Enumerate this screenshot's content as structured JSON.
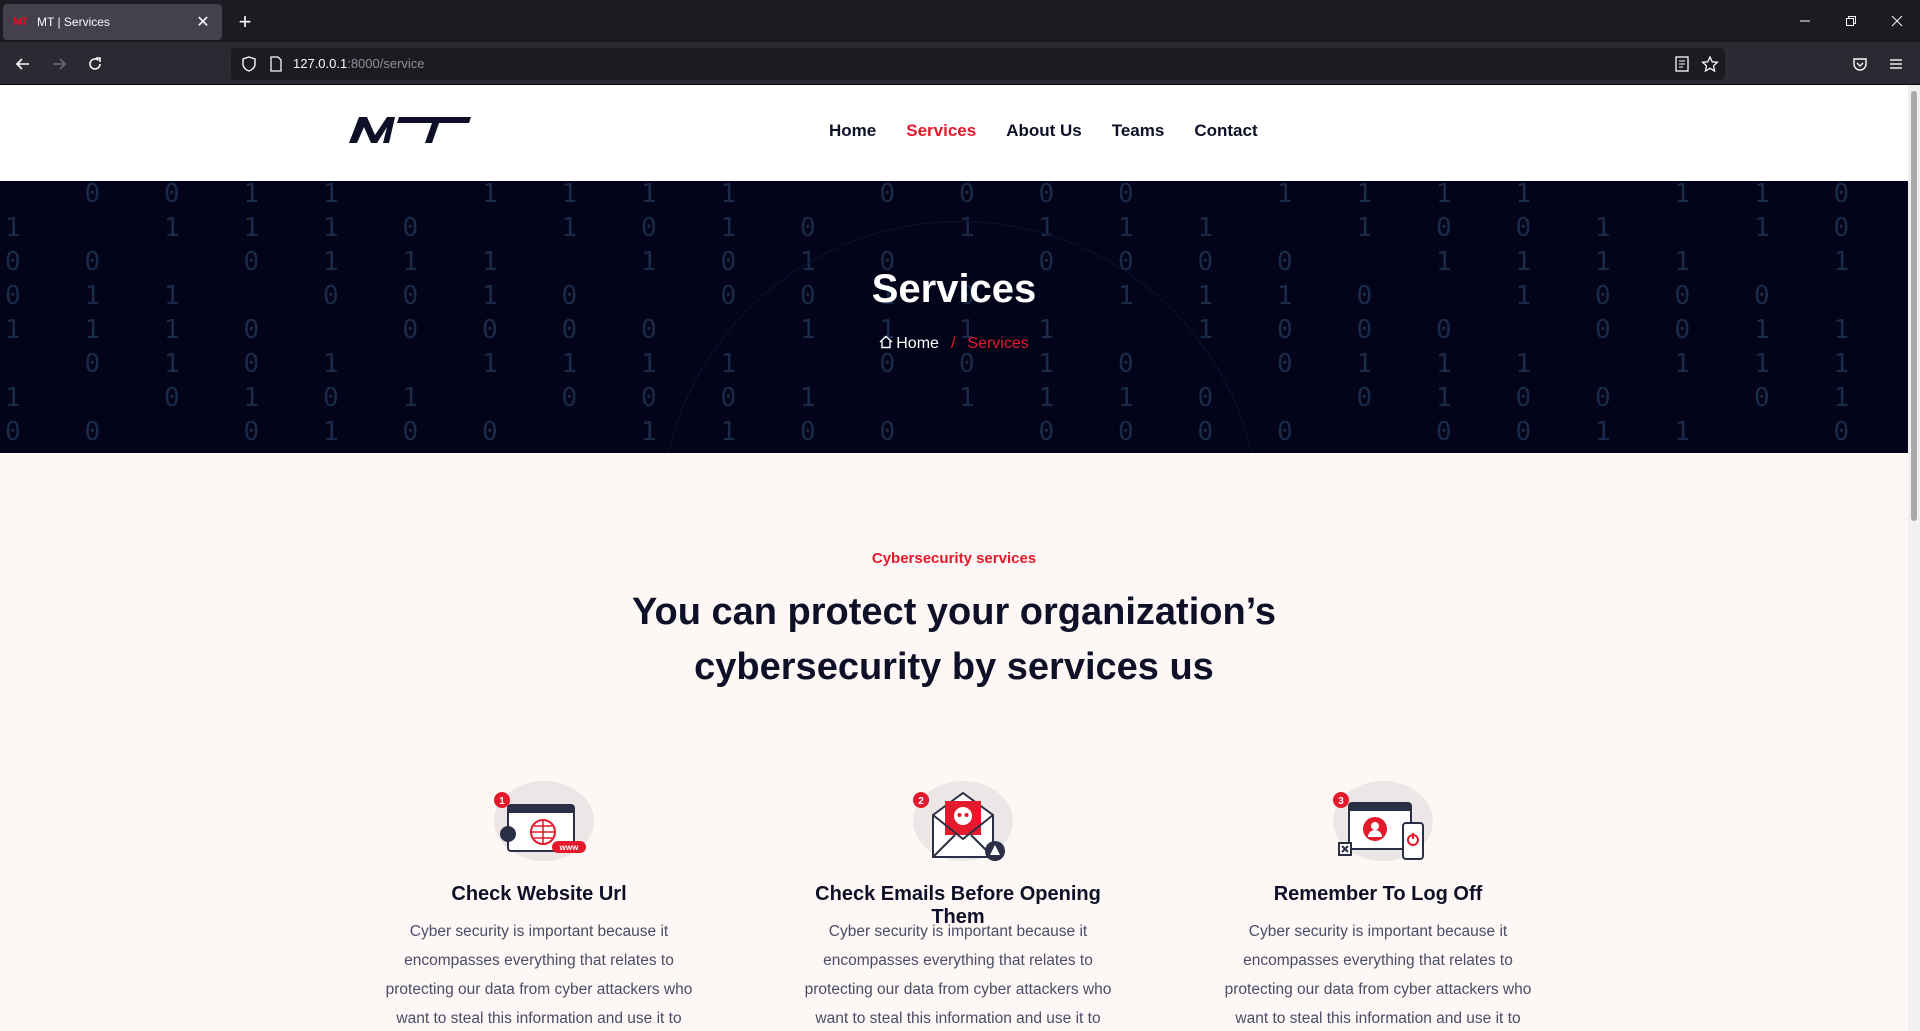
{
  "browser": {
    "tab_title": "MT | Services",
    "tab_favicon_text": "MT",
    "url_host": "127.0.0.1",
    "url_path": ":8000/service"
  },
  "header": {
    "menu": [
      {
        "label": "Home",
        "active": false
      },
      {
        "label": "Services",
        "active": true
      },
      {
        "label": "About Us",
        "active": false
      },
      {
        "label": "Teams",
        "active": false
      },
      {
        "label": "Contact",
        "active": false
      }
    ]
  },
  "hero": {
    "title": "Services",
    "breadcrumb_home": "Home",
    "breadcrumb_sep": "/",
    "breadcrumb_current": "Services"
  },
  "section": {
    "subtitle": "Cybersecurity services",
    "title_line1": "You can protect your organization’s",
    "title_line2": "cybersecurity by services us"
  },
  "cards": [
    {
      "number": "1",
      "title": "Check Website Url",
      "lines": [
        "Cyber security is important because it",
        "encompasses everything that relates to",
        "protecting our data from cyber attackers who",
        "want to steal this information and use it to"
      ]
    },
    {
      "number": "2",
      "title": "Check Emails Before Opening Them",
      "lines": [
        "Cyber security is important because it",
        "encompasses everything that relates to",
        "protecting our data from cyber attackers who",
        "want to steal this information and use it to"
      ]
    },
    {
      "number": "3",
      "title": "Remember To Log Off",
      "lines": [
        "Cyber security is important because it",
        "encompasses everything that relates to",
        "protecting our data from cyber attackers who",
        "want to steal this information and use it to"
      ]
    }
  ],
  "colors": {
    "accent": "#e4192b",
    "dark": "#0e1027",
    "hero_bg": "#03041a",
    "section_bg": "#fdf8f5"
  }
}
